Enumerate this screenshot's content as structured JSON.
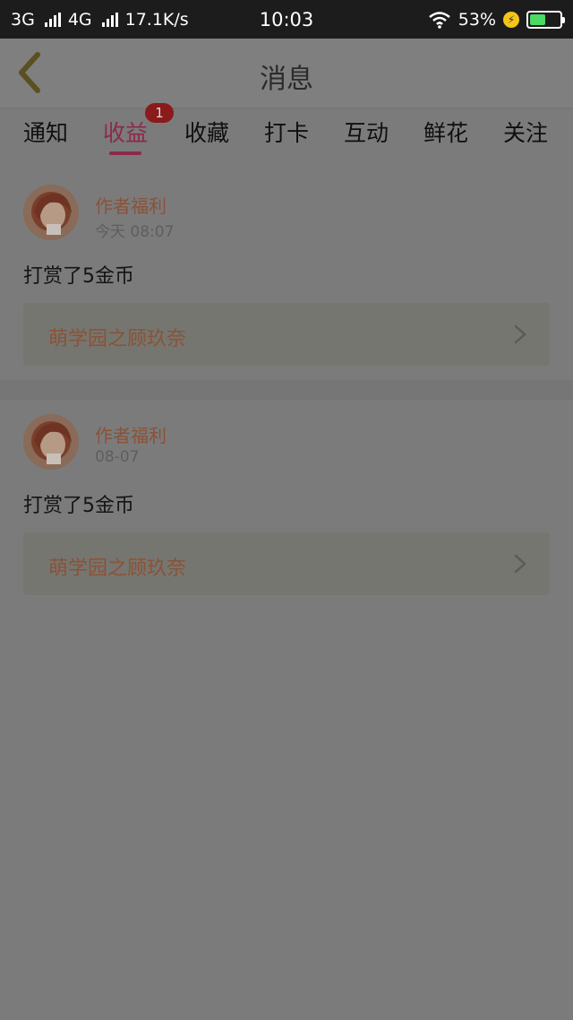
{
  "status_bar": {
    "network1": "3G",
    "network2": "4G",
    "speed": "17.1K/s",
    "time": "10:03",
    "battery": "53%",
    "battery_level": 0.53
  },
  "header": {
    "title": "消息",
    "back_icon": "chevron-left-icon"
  },
  "tabs": [
    {
      "label": "通知",
      "active": false
    },
    {
      "label": "收益",
      "active": true,
      "badge": "1"
    },
    {
      "label": "收藏",
      "active": false
    },
    {
      "label": "打卡",
      "active": false
    },
    {
      "label": "互动",
      "active": false
    },
    {
      "label": "鲜花",
      "active": false
    },
    {
      "label": "关注",
      "active": false
    }
  ],
  "messages": [
    {
      "sender": "作者福利",
      "time": "今天 08:07",
      "text": "打赏了5金币",
      "book": "萌学园之顾玖奈"
    },
    {
      "sender": "作者福利",
      "time": "08-07",
      "text": "打赏了5金币",
      "book": "萌学园之顾玖奈"
    }
  ],
  "colors": {
    "accent": "#8a2a4a",
    "link": "#8a5238",
    "overlay_bg": "#7b7b7b"
  }
}
